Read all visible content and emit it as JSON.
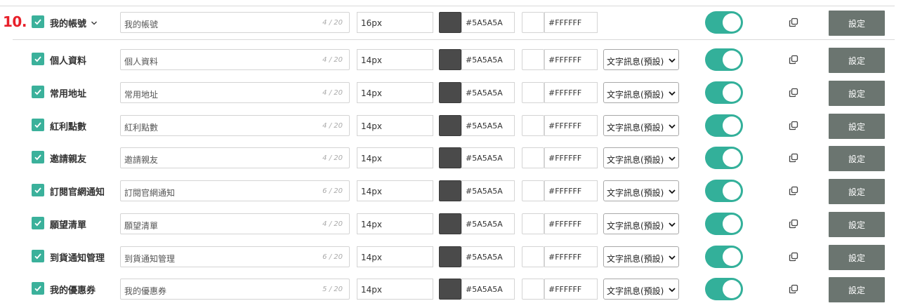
{
  "colors": {
    "accent": "#3bb19b",
    "toggle_on": "#33b09a",
    "button_bg": "#6b7570",
    "step_number": "#e8202a",
    "swatch_dark": "#4a4a4a",
    "swatch_light": "#FFFFFF"
  },
  "header": {
    "step_number": "10.",
    "checked": true,
    "label": "我的帳號",
    "expand_icon": "chevron-down-icon",
    "title_value": "我的帳號",
    "char_count": "4 / 20",
    "font_size": "16px",
    "text_color": "#5A5A5A",
    "bg_color": "#FFFFFF",
    "toggle_on": true,
    "copy_icon": "copy-icon",
    "settings_label": "設定"
  },
  "items": [
    {
      "checked": true,
      "label": "個人資料",
      "value": "個人資料",
      "count": "4 / 20",
      "font_size": "14px",
      "text_color": "#5A5A5A",
      "bg_color": "#FFFFFF",
      "display_type": "文字訊息(預設)",
      "toggle_on": true,
      "settings_label": "設定"
    },
    {
      "checked": true,
      "label": "常用地址",
      "value": "常用地址",
      "count": "4 / 20",
      "font_size": "14px",
      "text_color": "#5A5A5A",
      "bg_color": "#FFFFFF",
      "display_type": "文字訊息(預設)",
      "toggle_on": true,
      "settings_label": "設定"
    },
    {
      "checked": true,
      "label": "紅利點數",
      "value": "紅利點數",
      "count": "4 / 20",
      "font_size": "14px",
      "text_color": "#5A5A5A",
      "bg_color": "#FFFFFF",
      "display_type": "文字訊息(預設)",
      "toggle_on": true,
      "settings_label": "設定"
    },
    {
      "checked": true,
      "label": "邀請親友",
      "value": "邀請親友",
      "count": "4 / 20",
      "font_size": "14px",
      "text_color": "#5A5A5A",
      "bg_color": "#FFFFFF",
      "display_type": "文字訊息(預設)",
      "toggle_on": true,
      "settings_label": "設定"
    },
    {
      "checked": true,
      "label": "訂閱官網通知",
      "value": "訂閱官網通知",
      "count": "6 / 20",
      "font_size": "14px",
      "text_color": "#5A5A5A",
      "bg_color": "#FFFFFF",
      "display_type": "文字訊息(預設)",
      "toggle_on": true,
      "settings_label": "設定"
    },
    {
      "checked": true,
      "label": "願望清單",
      "value": "願望清單",
      "count": "4 / 20",
      "font_size": "14px",
      "text_color": "#5A5A5A",
      "bg_color": "#FFFFFF",
      "display_type": "文字訊息(預設)",
      "toggle_on": true,
      "settings_label": "設定"
    },
    {
      "checked": true,
      "label": "到貨通知管理",
      "value": "到貨通知管理",
      "count": "6 / 20",
      "font_size": "14px",
      "text_color": "#5A5A5A",
      "bg_color": "#FFFFFF",
      "display_type": "文字訊息(預設)",
      "toggle_on": true,
      "settings_label": "設定"
    },
    {
      "checked": true,
      "label": "我的優惠券",
      "value": "我的優惠券",
      "count": "5 / 20",
      "font_size": "14px",
      "text_color": "#5A5A5A",
      "bg_color": "#FFFFFF",
      "display_type": "文字訊息(預設)",
      "toggle_on": true,
      "settings_label": "設定"
    }
  ]
}
